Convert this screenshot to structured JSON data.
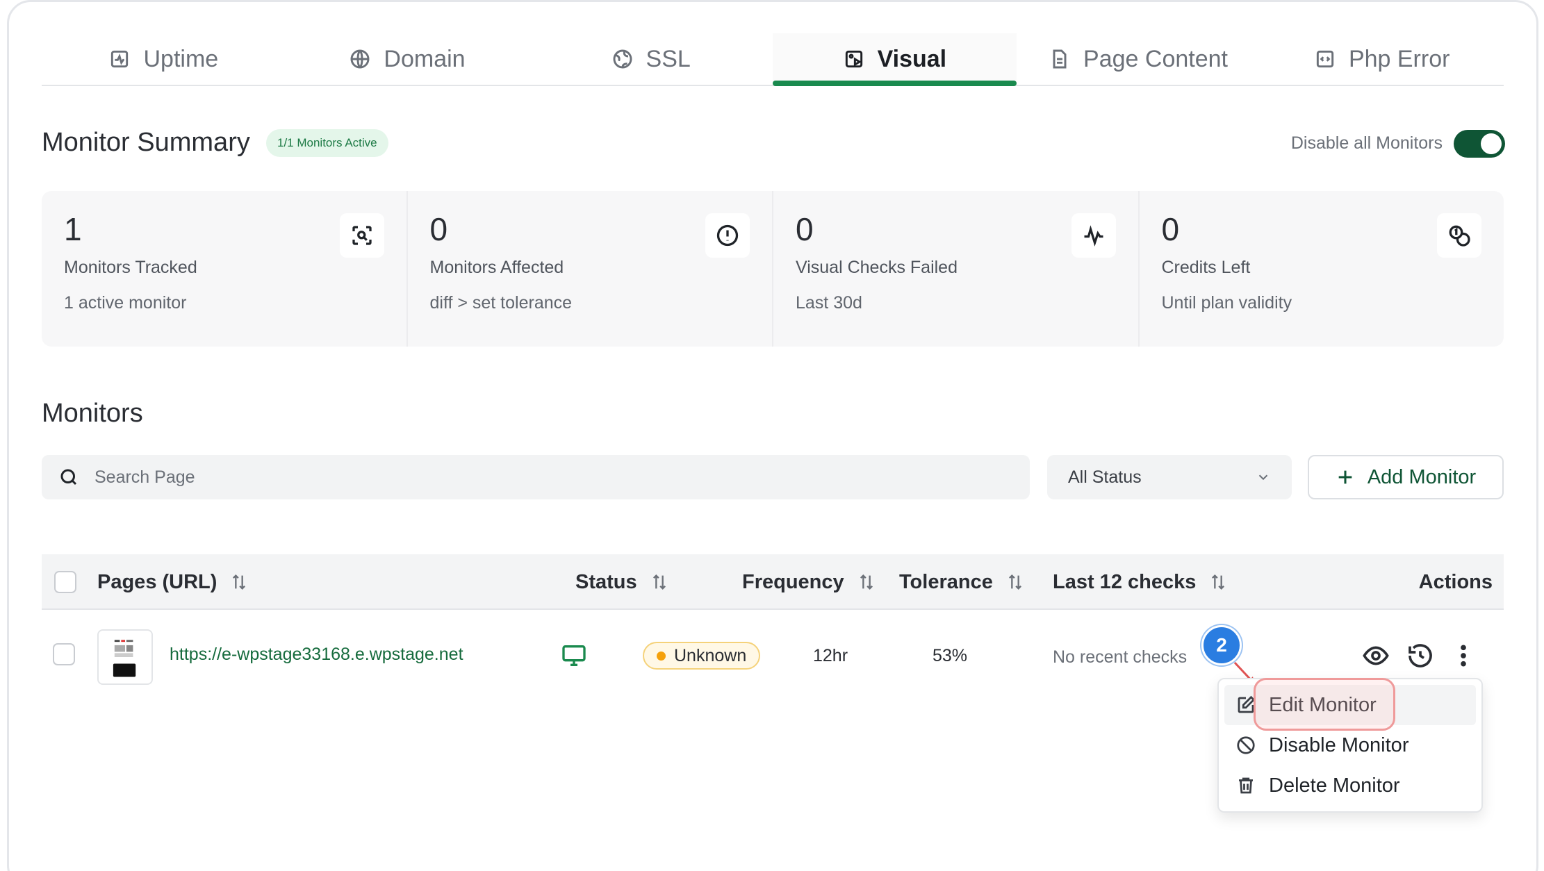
{
  "tabs": [
    {
      "label": "Uptime",
      "icon": "activity-icon"
    },
    {
      "label": "Domain",
      "icon": "globe-icon"
    },
    {
      "label": "SSL",
      "icon": "ssl-globe-icon"
    },
    {
      "label": "Visual",
      "icon": "visual-image-icon",
      "active": true
    },
    {
      "label": "Page Content",
      "icon": "document-icon"
    },
    {
      "label": "Php Error",
      "icon": "code-icon"
    }
  ],
  "summary": {
    "title": "Monitor Summary",
    "badge": "1/1 Monitors Active",
    "disable_label": "Disable all Monitors",
    "toggle_on": true
  },
  "stats": [
    {
      "value": "1",
      "label": "Monitors Tracked",
      "sub": "1 active monitor",
      "icon": "scan-search-icon"
    },
    {
      "value": "0",
      "label": "Monitors Affected",
      "sub": "diff > set tolerance",
      "icon": "alert-circle-icon"
    },
    {
      "value": "0",
      "label": "Visual Checks Failed",
      "sub": "Last 30d",
      "icon": "pulse-icon"
    },
    {
      "value": "0",
      "label": "Credits Left",
      "sub": "Until plan validity",
      "icon": "coins-icon"
    }
  ],
  "monitors": {
    "title": "Monitors",
    "search_placeholder": "Search Page",
    "status_filter": "All Status",
    "add_label": "Add Monitor"
  },
  "table": {
    "columns": [
      "Pages (URL)",
      "Status",
      "Frequency",
      "Tolerance",
      "Last 12 checks",
      "Actions"
    ],
    "rows": [
      {
        "url": "https://e-wpstage33168.e.wpstage.net",
        "device": "desktop-icon",
        "status": "Unknown",
        "frequency": "12hr",
        "tolerance": "53%",
        "last_checks": "No recent checks"
      }
    ]
  },
  "step_marker": "2",
  "menu": {
    "items": [
      "Edit Monitor",
      "Disable Monitor",
      "Delete Monitor"
    ]
  },
  "colors": {
    "accent": "#1a8a4e",
    "toggle": "#0f5535",
    "link": "#166b3d",
    "status_unknown": "#f5a10b",
    "marker": "#2a7de1"
  }
}
